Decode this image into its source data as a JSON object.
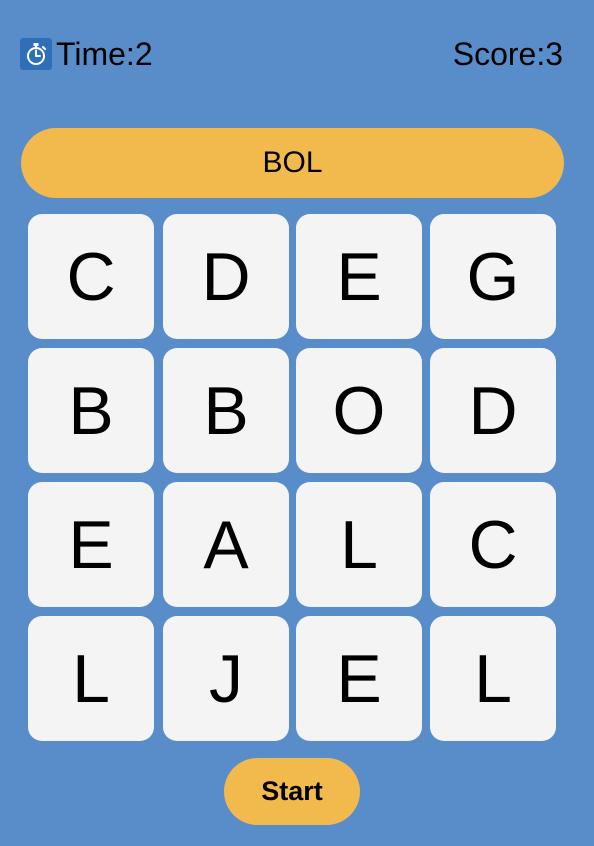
{
  "header": {
    "timer_icon": "stopwatch-icon",
    "time_label": "Time:",
    "time_value": "2",
    "score_label": "Score:",
    "score_value": "3"
  },
  "current_word": "BOL",
  "grid": [
    [
      "C",
      "D",
      "E",
      "G"
    ],
    [
      "B",
      "B",
      "O",
      "D"
    ],
    [
      "E",
      "A",
      "L",
      "C"
    ],
    [
      "L",
      "J",
      "E",
      "L"
    ]
  ],
  "start_label": "Start",
  "colors": {
    "background": "#588dca",
    "accent": "#f2b94c",
    "tile": "#f4f4f4",
    "icon_background": "#2f6fb8"
  }
}
